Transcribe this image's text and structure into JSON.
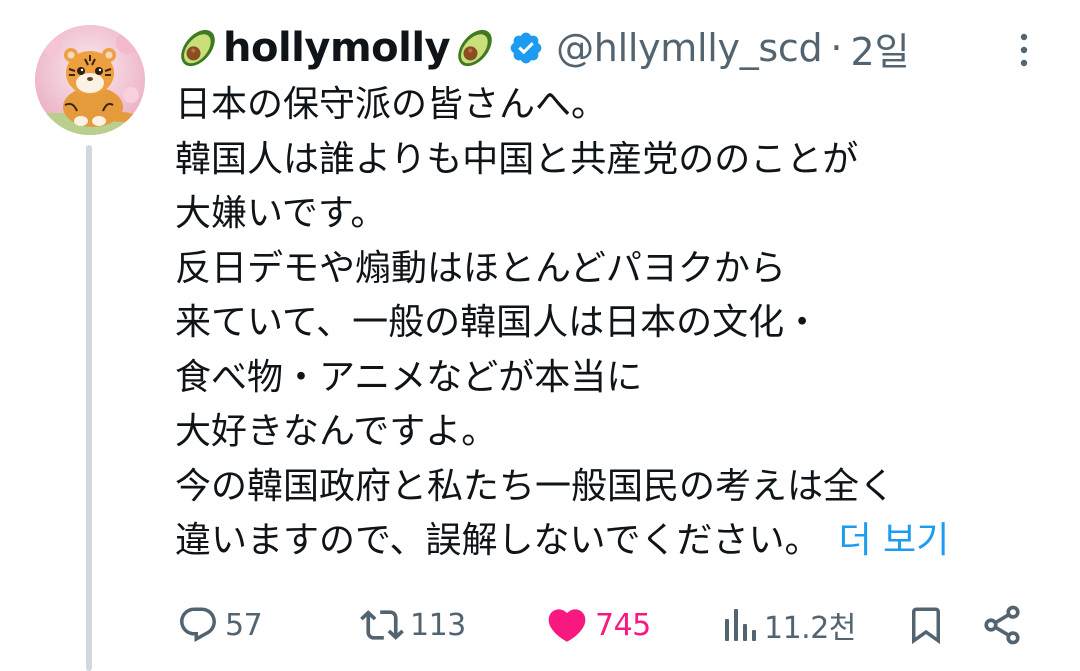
{
  "author": {
    "display_name": "hollymolly",
    "handle": "@hllymlly_scd",
    "time": "2일",
    "verified": true,
    "avatar_icon": "tiger-avatar",
    "name_emoji": "avocado"
  },
  "tweet": {
    "lines": [
      "日本の保守派の皆さんへ。",
      "韓国人は誰よりも中国と共産党ののことが",
      "大嫌いです。",
      "反日デモや煽動はほとんどパヨクから",
      "来ていて、一般の韓国人は日本の文化・",
      "食べ物・アニメなどが本当に",
      "大好きなんですよ。",
      "今の韓国政府と私たち一般国民の考えは全く",
      "違いますので、誤解しないでください。"
    ],
    "show_more_label": "더 보기"
  },
  "actions": {
    "replies": "57",
    "reposts": "113",
    "likes": "745",
    "views": "11.2천",
    "liked": true
  },
  "colors": {
    "text": "#0f1419",
    "muted": "#536471",
    "link": "#1d9bf0",
    "like": "#f91880",
    "thread_line": "#cfd9de"
  }
}
